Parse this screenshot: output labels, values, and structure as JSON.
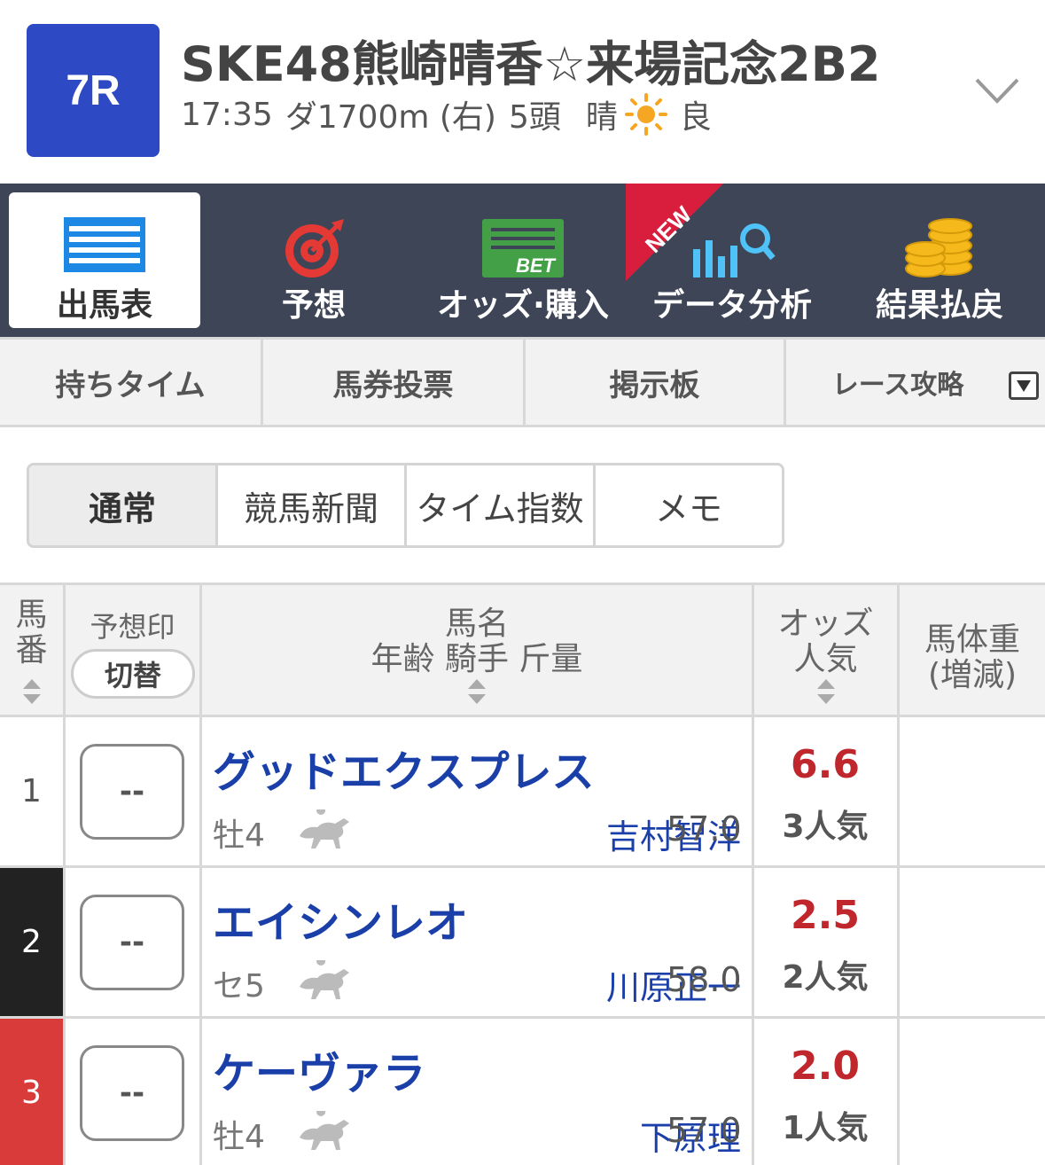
{
  "race": {
    "number": "7R",
    "title": "SKE48熊崎晴香☆来場記念2B2",
    "time": "17:35",
    "course": "ダ1700m (右)",
    "runners": "5頭",
    "weather": "晴",
    "track": "良"
  },
  "nav": {
    "items": [
      {
        "label": "出馬表",
        "icon": "entry-table-icon"
      },
      {
        "label": "予想",
        "icon": "target-icon"
      },
      {
        "label": "オッズ·購入",
        "icon": "bet-icon"
      },
      {
        "label": "データ分析",
        "icon": "data-analysis-icon"
      },
      {
        "label": "結果払戻",
        "icon": "coins-icon"
      }
    ],
    "new_badge": "NEW"
  },
  "subtabs": [
    "持ちタイム",
    "馬券投票",
    "掲示板",
    "レース攻略"
  ],
  "view_modes": [
    "通常",
    "競馬新聞",
    "タイム指数",
    "メモ"
  ],
  "table": {
    "headers": {
      "num_top": "馬",
      "num_bottom": "番",
      "mark_label": "予想印",
      "mark_toggle": "切替",
      "horse_line1": "馬名",
      "horse_line2": "年齢 騎手 斤量",
      "odds_line1": "オッズ",
      "odds_line2": "人気",
      "weight_line1": "馬体重",
      "weight_line2": "(増減)"
    },
    "rows": [
      {
        "num": "1",
        "mark": "--",
        "name": "グッドエクスプレス",
        "age": "牡4",
        "jockey": "吉村智洋",
        "weight": "57.0",
        "odds": "6.6",
        "pop": "3人気"
      },
      {
        "num": "2",
        "mark": "--",
        "name": "エイシンレオ",
        "age": "セ5",
        "jockey": "川原正一",
        "weight": "58.0",
        "odds": "2.5",
        "pop": "2人気"
      },
      {
        "num": "3",
        "mark": "--",
        "name": "ケーヴァラ",
        "age": "牡4",
        "jockey": "下原理",
        "weight": "57.0",
        "odds": "2.0",
        "pop": "1人気"
      }
    ]
  },
  "colors": {
    "race_badge": "#2d4ac4",
    "navbar": "#3e4557",
    "horse_name": "#1a3fa8",
    "odds": "#c0272d",
    "gate1": "#ffffff",
    "gate2": "#222222",
    "gate3": "#d93a3a"
  }
}
